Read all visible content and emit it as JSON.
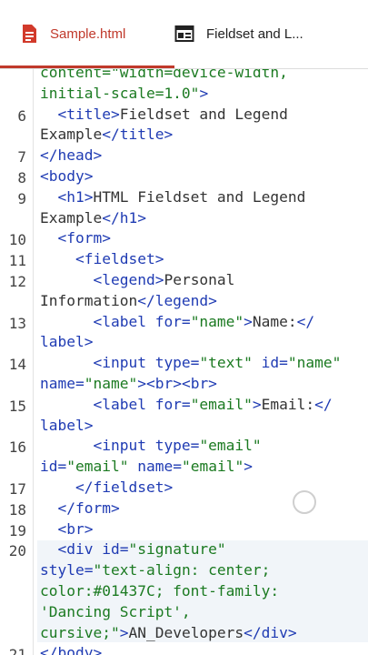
{
  "tabs": [
    {
      "label": "Sample.html",
      "active": true,
      "icon": "html-file-icon"
    },
    {
      "label": "Fieldset and L...",
      "active": false,
      "icon": "browser-window-icon"
    }
  ],
  "colors": {
    "accent": "#c0392b",
    "tag": "#1f3bb3",
    "string": "#1b7a21",
    "text": "#333333"
  },
  "editor": {
    "line_numbers": [
      "6",
      "7",
      "8",
      "9",
      "10",
      "11",
      "12",
      "13",
      "14",
      "15",
      "16",
      "17",
      "18",
      "19",
      "20",
      "21"
    ],
    "highlighted_line": "20",
    "rows": [
      [
        {
          "t": "s",
          "v": "content=\"width=device-width,"
        }
      ],
      [
        {
          "t": "s",
          "v": "initial-scale=1.0\""
        },
        {
          "t": "t",
          "v": ">"
        }
      ],
      [
        {
          "t": "t",
          "v": "  <title>"
        },
        {
          "t": "x",
          "v": "Fieldset and Legend"
        }
      ],
      [
        {
          "t": "x",
          "v": "Example"
        },
        {
          "t": "t",
          "v": "</title>"
        }
      ],
      [
        {
          "t": "t",
          "v": "</head>"
        }
      ],
      [
        {
          "t": "t",
          "v": "<body>"
        }
      ],
      [
        {
          "t": "t",
          "v": "  <h1>"
        },
        {
          "t": "x",
          "v": "HTML Fieldset and Legend"
        }
      ],
      [
        {
          "t": "x",
          "v": "Example"
        },
        {
          "t": "t",
          "v": "</h1>"
        }
      ],
      [
        {
          "t": "t",
          "v": "  <form>"
        }
      ],
      [
        {
          "t": "t",
          "v": "    <fieldset>"
        }
      ],
      [
        {
          "t": "t",
          "v": "      <legend>"
        },
        {
          "t": "x",
          "v": "Personal"
        }
      ],
      [
        {
          "t": "x",
          "v": "Information"
        },
        {
          "t": "t",
          "v": "</legend>"
        }
      ],
      [
        {
          "t": "t",
          "v": "      <label for="
        },
        {
          "t": "s",
          "v": "\"name\""
        },
        {
          "t": "t",
          "v": ">"
        },
        {
          "t": "x",
          "v": "Name:"
        },
        {
          "t": "t",
          "v": "</"
        }
      ],
      [
        {
          "t": "t",
          "v": "label>"
        }
      ],
      [
        {
          "t": "t",
          "v": "      <input type="
        },
        {
          "t": "s",
          "v": "\"text\""
        },
        {
          "t": "t",
          "v": " id="
        },
        {
          "t": "s",
          "v": "\"name\""
        }
      ],
      [
        {
          "t": "t",
          "v": "name="
        },
        {
          "t": "s",
          "v": "\"name\""
        },
        {
          "t": "t",
          "v": "><br><br>"
        }
      ],
      [
        {
          "t": "t",
          "v": "      <label for="
        },
        {
          "t": "s",
          "v": "\"email\""
        },
        {
          "t": "t",
          "v": ">"
        },
        {
          "t": "x",
          "v": "Email:"
        },
        {
          "t": "t",
          "v": "</"
        }
      ],
      [
        {
          "t": "t",
          "v": "label>"
        }
      ],
      [
        {
          "t": "t",
          "v": "      <input type="
        },
        {
          "t": "s",
          "v": "\"email\""
        }
      ],
      [
        {
          "t": "t",
          "v": "id="
        },
        {
          "t": "s",
          "v": "\"email\""
        },
        {
          "t": "t",
          "v": " name="
        },
        {
          "t": "s",
          "v": "\"email\""
        },
        {
          "t": "t",
          "v": ">"
        }
      ],
      [
        {
          "t": "t",
          "v": "    </fieldset>"
        }
      ],
      [
        {
          "t": "t",
          "v": "  </form>"
        }
      ],
      [
        {
          "t": "t",
          "v": "  <br>"
        }
      ],
      [
        {
          "t": "t",
          "v": "  <div id="
        },
        {
          "t": "s",
          "v": "\"signature\""
        }
      ],
      [
        {
          "t": "t",
          "v": "style="
        },
        {
          "t": "s",
          "v": "\"text-align: center;"
        }
      ],
      [
        {
          "t": "s",
          "v": "color:#01437C; font-family:"
        }
      ],
      [
        {
          "t": "s",
          "v": "'Dancing Script',"
        }
      ],
      [
        {
          "t": "s",
          "v": "cursive;\""
        },
        {
          "t": "t",
          "v": ">"
        },
        {
          "t": "x",
          "v": "AN_Developers"
        },
        {
          "t": "t",
          "v": "</div>"
        }
      ],
      [
        {
          "t": "t",
          "v": "</body>"
        }
      ]
    ]
  }
}
